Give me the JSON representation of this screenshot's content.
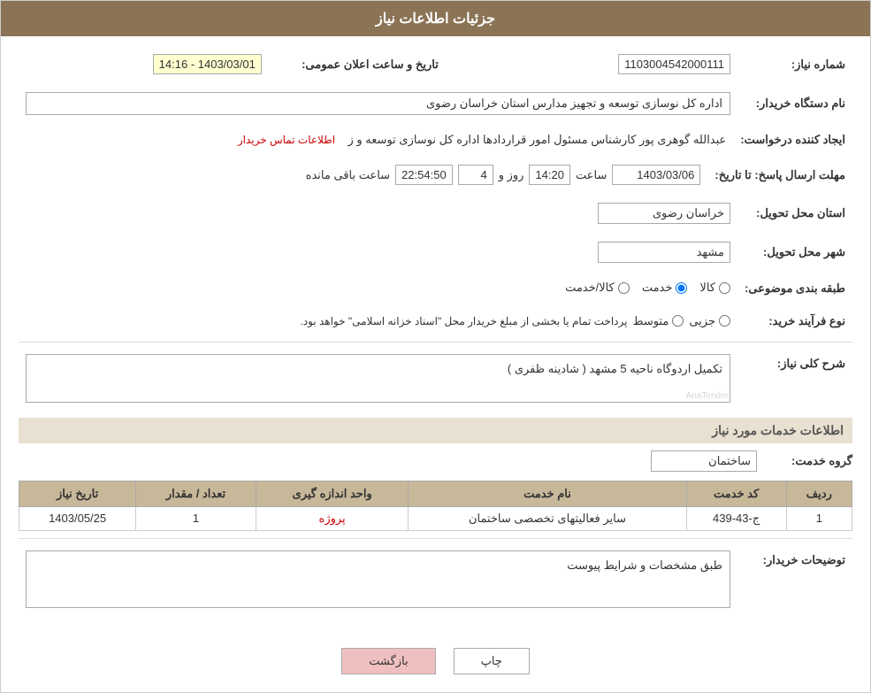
{
  "page": {
    "title": "جزئیات اطلاعات نیاز",
    "header_bg": "#8B7355"
  },
  "fields": {
    "need_number_label": "شماره نیاز:",
    "need_number_value": "1103004542000111",
    "buyer_name_label": "نام دستگاه خریدار:",
    "buyer_name_value": "اداره کل نوسازی  توسعه و تجهیز مدارس استان خراسان رضوی",
    "creator_label": "ایجاد کننده درخواست:",
    "creator_value": "عبدالله گوهری پور کارشناس مسئول امور قراردادها  اداره کل نوسازی  توسعه و ز",
    "contact_link": "اطلاعات تماس خریدار",
    "response_date_label": "مهلت ارسال پاسخ: تا تاریخ:",
    "response_date": "1403/03/06",
    "response_time_label": "ساعت",
    "response_time": "14:20",
    "response_days_label": "روز و",
    "response_days": "4",
    "response_remaining_label": "ساعت باقی مانده",
    "response_remaining": "22:54:50",
    "announce_label": "تاریخ و ساعت اعلان عمومی:",
    "announce_value": "1403/03/01 - 14:16",
    "province_label": "استان محل تحویل:",
    "province_value": "خراسان رضوی",
    "city_label": "شهر محل تحویل:",
    "city_value": "مشهد",
    "category_label": "طبقه بندی موضوعی:",
    "category_options": [
      "کالا",
      "خدمت",
      "کالا/خدمت"
    ],
    "category_selected": "خدمت",
    "purchase_type_label": "نوع فرآیند خرید:",
    "purchase_options": [
      "جزیی",
      "متوسط"
    ],
    "purchase_note": "پرداخت تمام یا بخشی از مبلغ خریدار محل \"اسناد خزانه اسلامی\" خواهد بود.",
    "need_desc_label": "شرح کلی نیاز:",
    "need_desc_value": "تکمیل اردوگاه ناحیه 5 مشهد ( شادینه ظفری )",
    "services_section_label": "اطلاعات خدمات مورد نیاز",
    "service_group_label": "گروه خدمت:",
    "service_group_value": "ساختمان",
    "table": {
      "headers": [
        "ردیف",
        "کد خدمت",
        "نام خدمت",
        "واحد اندازه گیری",
        "تعداد / مقدار",
        "تاریخ نیاز"
      ],
      "rows": [
        {
          "row_num": "1",
          "service_code": "ج-43-439",
          "service_name": "سایر فعالیتهای تخصصی ساختمان",
          "unit": "پروژه",
          "quantity": "1",
          "date": "1403/05/25"
        }
      ]
    },
    "buyer_desc_label": "توضیحات خریدار:",
    "buyer_desc_value": "طبق مشخصات و شرایط پیوست"
  },
  "buttons": {
    "print": "چاپ",
    "back": "بازگشت"
  }
}
